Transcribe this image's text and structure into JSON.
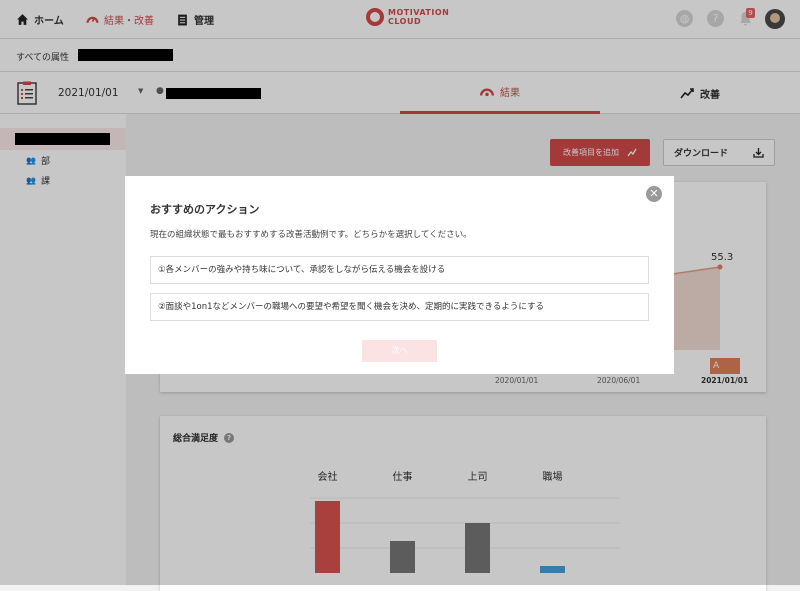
{
  "nav": {
    "home_label": "ホーム",
    "results_label": "結果・改善",
    "admin_label": "管理",
    "logo_line1": "MOTIVATION",
    "logo_line2": "CLOUD",
    "notification_count": "9",
    "brand_color": "#d24a4a"
  },
  "attribute_bar": {
    "label": "すべての属性"
  },
  "tab_bar": {
    "date": "2021/01/01",
    "tab_results": "結果",
    "tab_improve": "改善"
  },
  "sidebar": {
    "items": [
      {
        "label": "部",
        "icon": "group-icon"
      },
      {
        "label": "課",
        "icon": "group-icon"
      }
    ]
  },
  "toolbar": {
    "add_label": "改善項目を追加",
    "download_label": "ダウンロード"
  },
  "trend_chart": {
    "x_labels": [
      "2020/01/01",
      "2020/06/01",
      "2021/01/01"
    ],
    "last_value_label": "55.3",
    "grade_badge": "A"
  },
  "satisfaction": {
    "title": "総合満足度",
    "chart_data": {
      "type": "bar",
      "categories": [
        "会社",
        "仕事",
        "上司",
        "職場"
      ],
      "values": [
        72,
        32,
        50,
        7
      ],
      "colors": [
        "#d9534f",
        "#777777",
        "#777777",
        "#4a9fd4"
      ],
      "ylim": [
        0,
        100
      ]
    }
  },
  "modal": {
    "title": "おすすめのアクション",
    "description": "現在の組織状態で最もおすすめする改善活動例です。どちらかを選択してください。",
    "options": [
      "①各メンバーの強みや持ち味について、承認をしながら伝える機会を設ける",
      "②面談や1on1などメンバーの職場への要望や希望を聞く機会を決め、定期的に実践できるようにする"
    ],
    "next_label": "次へ"
  }
}
